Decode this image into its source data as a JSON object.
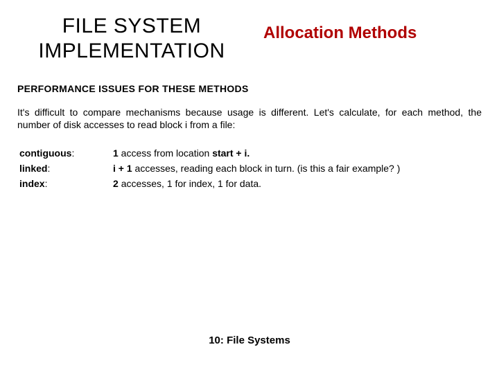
{
  "header": {
    "left_line1": "FILE SYSTEM",
    "left_line2": "IMPLEMENTATION",
    "right": "Allocation Methods"
  },
  "section_heading": "PERFORMANCE ISSUES FOR THESE METHODS",
  "body": " It's difficult to compare mechanisms because usage is different. Let's calculate, for each method, the number of disk accesses to read block i from a file:",
  "methods": {
    "labels": {
      "contiguous": "contiguous",
      "linked": "linked",
      "index": "index"
    },
    "values": {
      "contiguous_prefix_bold": "1",
      "contiguous_mid": " access from location ",
      "contiguous_bold2": "start + i.",
      "linked_bold": "i + 1 ",
      "linked_rest": "accesses, reading each block in turn. (is this a fair example? )",
      "index_bold": "2 ",
      "index_rest": "accesses, 1 for index, 1 for data."
    }
  },
  "footer": "10: File Systems"
}
